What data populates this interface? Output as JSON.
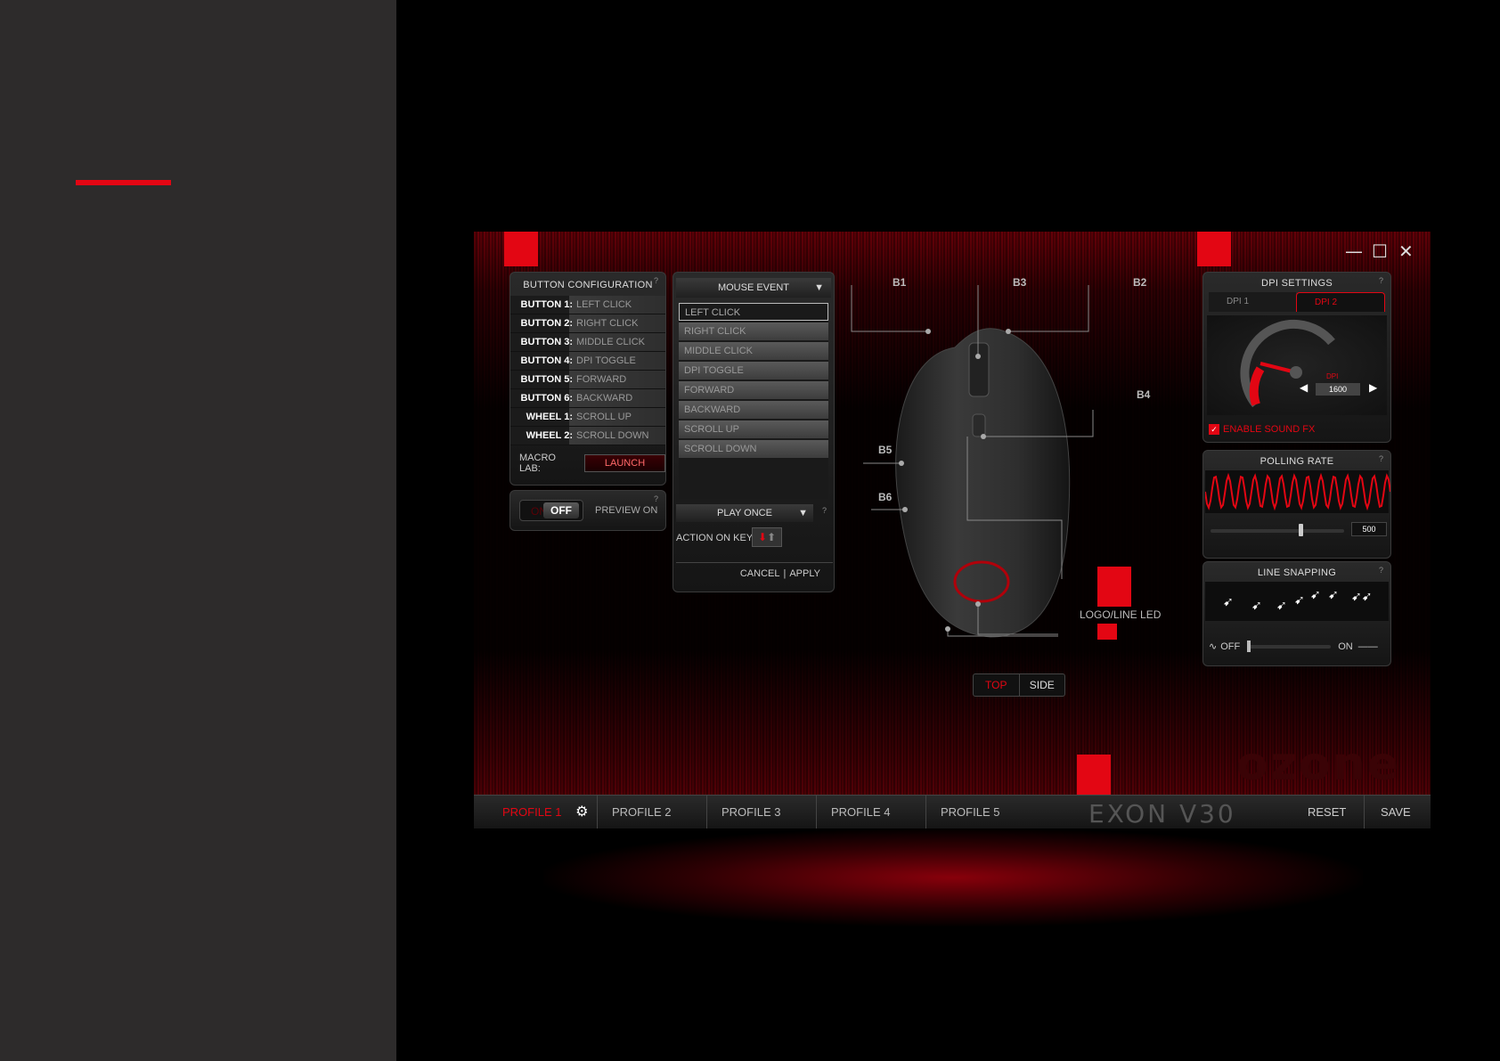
{
  "colors": {
    "accent": "#e30613",
    "panel_bg": "#2d2b2b",
    "background": "#000000"
  },
  "window_controls": {
    "minimize": "—",
    "maximize": "☐",
    "close": "✕"
  },
  "button_config": {
    "title": "BUTTON CONFIGURATION",
    "rows": [
      {
        "key": "BUTTON 1:",
        "value": "LEFT CLICK"
      },
      {
        "key": "BUTTON 2:",
        "value": "RIGHT CLICK"
      },
      {
        "key": "BUTTON 3:",
        "value": "MIDDLE CLICK"
      },
      {
        "key": "BUTTON 4:",
        "value": "DPI TOGGLE"
      },
      {
        "key": "BUTTON 5:",
        "value": "FORWARD"
      },
      {
        "key": "BUTTON 6:",
        "value": "BACKWARD"
      },
      {
        "key": "WHEEL 1:",
        "value": "SCROLL UP"
      },
      {
        "key": "WHEEL 2:",
        "value": "SCROLL DOWN"
      }
    ],
    "macro_label": "MACRO LAB:",
    "launch_label": "LAUNCH",
    "help": "?"
  },
  "preview": {
    "on": "ON",
    "off": "OFF",
    "label": "PREVIEW ON"
  },
  "mouse_event": {
    "header": "MOUSE EVENT",
    "items": [
      "LEFT CLICK",
      "RIGHT CLICK",
      "MIDDLE CLICK",
      "DPI TOGGLE",
      "FORWARD",
      "BACKWARD",
      "SCROLL UP",
      "SCROLL DOWN"
    ],
    "play_mode": "PLAY ONCE",
    "action_label": "ACTION ON KEY",
    "cancel": "CANCEL",
    "apply": "APPLY"
  },
  "mouse_labels": {
    "b1": "B1",
    "b2": "B2",
    "b3": "B3",
    "b4": "B4",
    "b5": "B5",
    "b6": "B6",
    "led": "LOGO/LINE LED"
  },
  "view_switch": {
    "top": "TOP",
    "side": "SIDE"
  },
  "dpi": {
    "title": "DPI SETTINGS",
    "tab1": "DPI 1",
    "tab2": "DPI 2",
    "label": "DPI",
    "value": "1600",
    "sound_fx": "ENABLE SOUND FX"
  },
  "polling": {
    "title": "POLLING RATE",
    "value": "500",
    "slider_fraction": 0.68
  },
  "line_snapping": {
    "title": "LINE SNAPPING",
    "off": "OFF",
    "on": "ON",
    "slider_fraction": 0.0
  },
  "watermark": "ozone",
  "bottom": {
    "profiles": [
      "PROFILE 1",
      "PROFILE 2",
      "PROFILE 3",
      "PROFILE 4",
      "PROFILE 5"
    ],
    "product": "EXON V30",
    "reset": "RESET",
    "save": "SAVE"
  }
}
